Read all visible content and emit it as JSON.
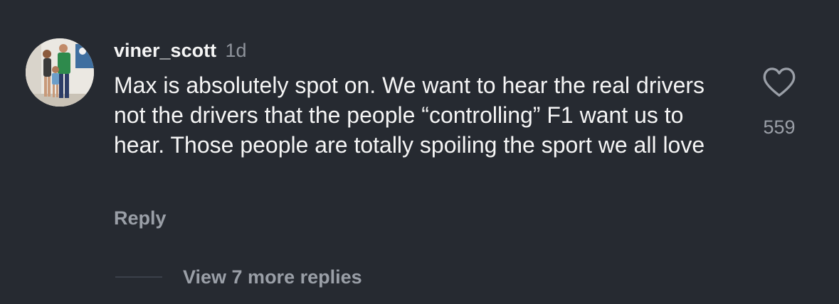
{
  "comment": {
    "username": "viner_scott",
    "timestamp": "1d",
    "text": "Max is absolutely spot on. We want to hear the real drivers not the drivers that the people “controlling” F1 want us to hear. Those people are totally spoiling the sport we all love",
    "like_count": "559",
    "reply_label": "Reply",
    "view_replies_label": "View 7 more replies"
  },
  "icons": {
    "avatar": "profile-photo-avatar",
    "like": "heart-outline-icon"
  },
  "colors": {
    "background": "#262a31",
    "primary_text": "#f5f5f5",
    "secondary_text": "#9a9fa7",
    "timestamp": "#8e939b"
  }
}
